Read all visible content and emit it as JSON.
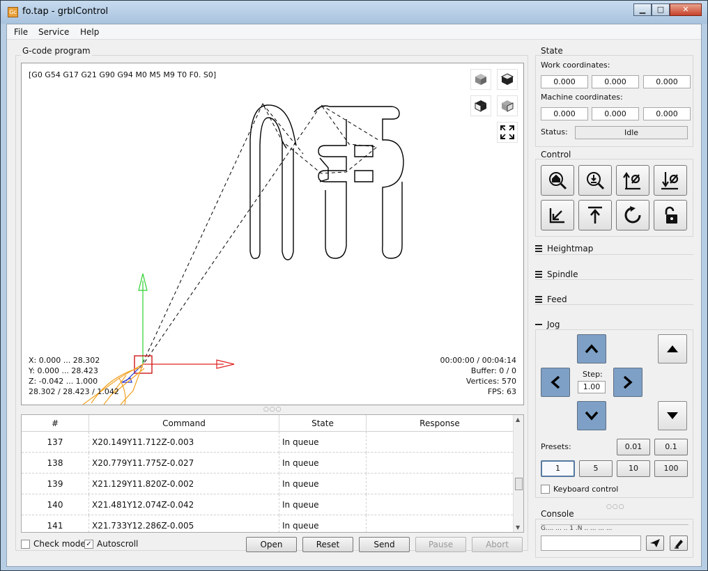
{
  "window": {
    "title": "fo.tap - grblControl",
    "app_icon": "grblControl-icon"
  },
  "menu": [
    "File",
    "Service",
    "Help"
  ],
  "gcode": {
    "group_title": "G-code program",
    "modal_state": "[G0 G54 G17 G21 G90 G94 M0 M5 M9 T0 F0. S0]",
    "bounds": {
      "x": "X: 0.000 ... 28.302",
      "y": "Y: 0.000 ... 28.423",
      "z": "Z: -0.042 ... 1.000",
      "size": "28.302 / 28.423 / 1.042"
    },
    "stats": {
      "time": "00:00:00 / 00:04:14",
      "buffer": "Buffer: 0 / 0",
      "vertices": "Vertices: 570",
      "fps": "FPS: 63"
    },
    "view_buttons": [
      "isometric-view-icon",
      "top-view-icon",
      "front-view-icon",
      "left-view-icon",
      "fit-view-icon"
    ]
  },
  "table": {
    "columns": [
      "#",
      "Command",
      "State",
      "Response"
    ],
    "rows": [
      [
        "137",
        "X20.149Y11.712Z-0.003",
        "In queue",
        ""
      ],
      [
        "138",
        "X20.779Y11.775Z-0.027",
        "In queue",
        ""
      ],
      [
        "139",
        "X21.129Y11.820Z-0.002",
        "In queue",
        ""
      ],
      [
        "140",
        "X21.481Y12.074Z-0.042",
        "In queue",
        ""
      ],
      [
        "141",
        "X21.733Y12.286Z-0.005",
        "In queue",
        ""
      ]
    ]
  },
  "options": {
    "check_mode": {
      "label": "Check mode",
      "checked": false
    },
    "autoscroll": {
      "label": "Autoscroll",
      "checked": true
    }
  },
  "actions": {
    "open": "Open",
    "reset": "Reset",
    "send": "Send",
    "pause": "Pause",
    "abort": "Abort"
  },
  "state": {
    "title": "State",
    "work_label": "Work coordinates:",
    "work": [
      "0.000",
      "0.000",
      "0.000"
    ],
    "machine_label": "Machine coordinates:",
    "machine": [
      "0.000",
      "0.000",
      "0.000"
    ],
    "status_label": "Status:",
    "status": "Idle"
  },
  "control": {
    "title": "Control",
    "buttons": [
      "home-icon",
      "zero-probe-icon",
      "zero-xy-icon",
      "zero-z-icon",
      "restore-origin-icon",
      "safe-position-icon",
      "reset-icon",
      "unlock-icon"
    ]
  },
  "sections": {
    "heightmap": "Heightmap",
    "spindle": "Spindle",
    "feed": "Feed",
    "jog": "Jog"
  },
  "jog": {
    "step_label": "Step:",
    "step_value": "1.00",
    "presets_label": "Presets:",
    "presets_small": [
      "0.01",
      "0.1"
    ],
    "presets": [
      "1",
      "5",
      "10",
      "100"
    ],
    "active_preset": "1",
    "keyboard_label": "Keyboard control"
  },
  "console": {
    "title": "Console",
    "combo_text": "G.... ... .. 1 .N .. ...  ...  ... "
  }
}
